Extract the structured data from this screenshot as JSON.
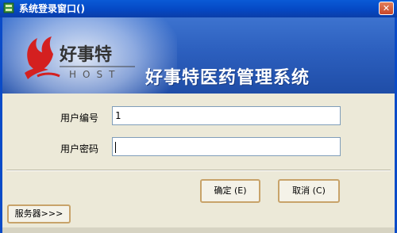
{
  "window": {
    "title": "系统登录窗口()",
    "close_glyph": "✕"
  },
  "banner": {
    "logo_text": "好事特",
    "logo_subtext": "HOST",
    "app_name": "好事特医药管理系统"
  },
  "form": {
    "user_id_label": "用户编号",
    "user_id_value": "1",
    "password_label": "用户密码",
    "password_value": ""
  },
  "buttons": {
    "ok_label": "确定 (E)",
    "cancel_label": "取消 (C)",
    "server_label": "服务器>>>"
  },
  "colors": {
    "titlebar": "#0548c4",
    "banner": "#2c5fbe",
    "logo_red": "#d42020",
    "button_border": "#c8a36a"
  }
}
